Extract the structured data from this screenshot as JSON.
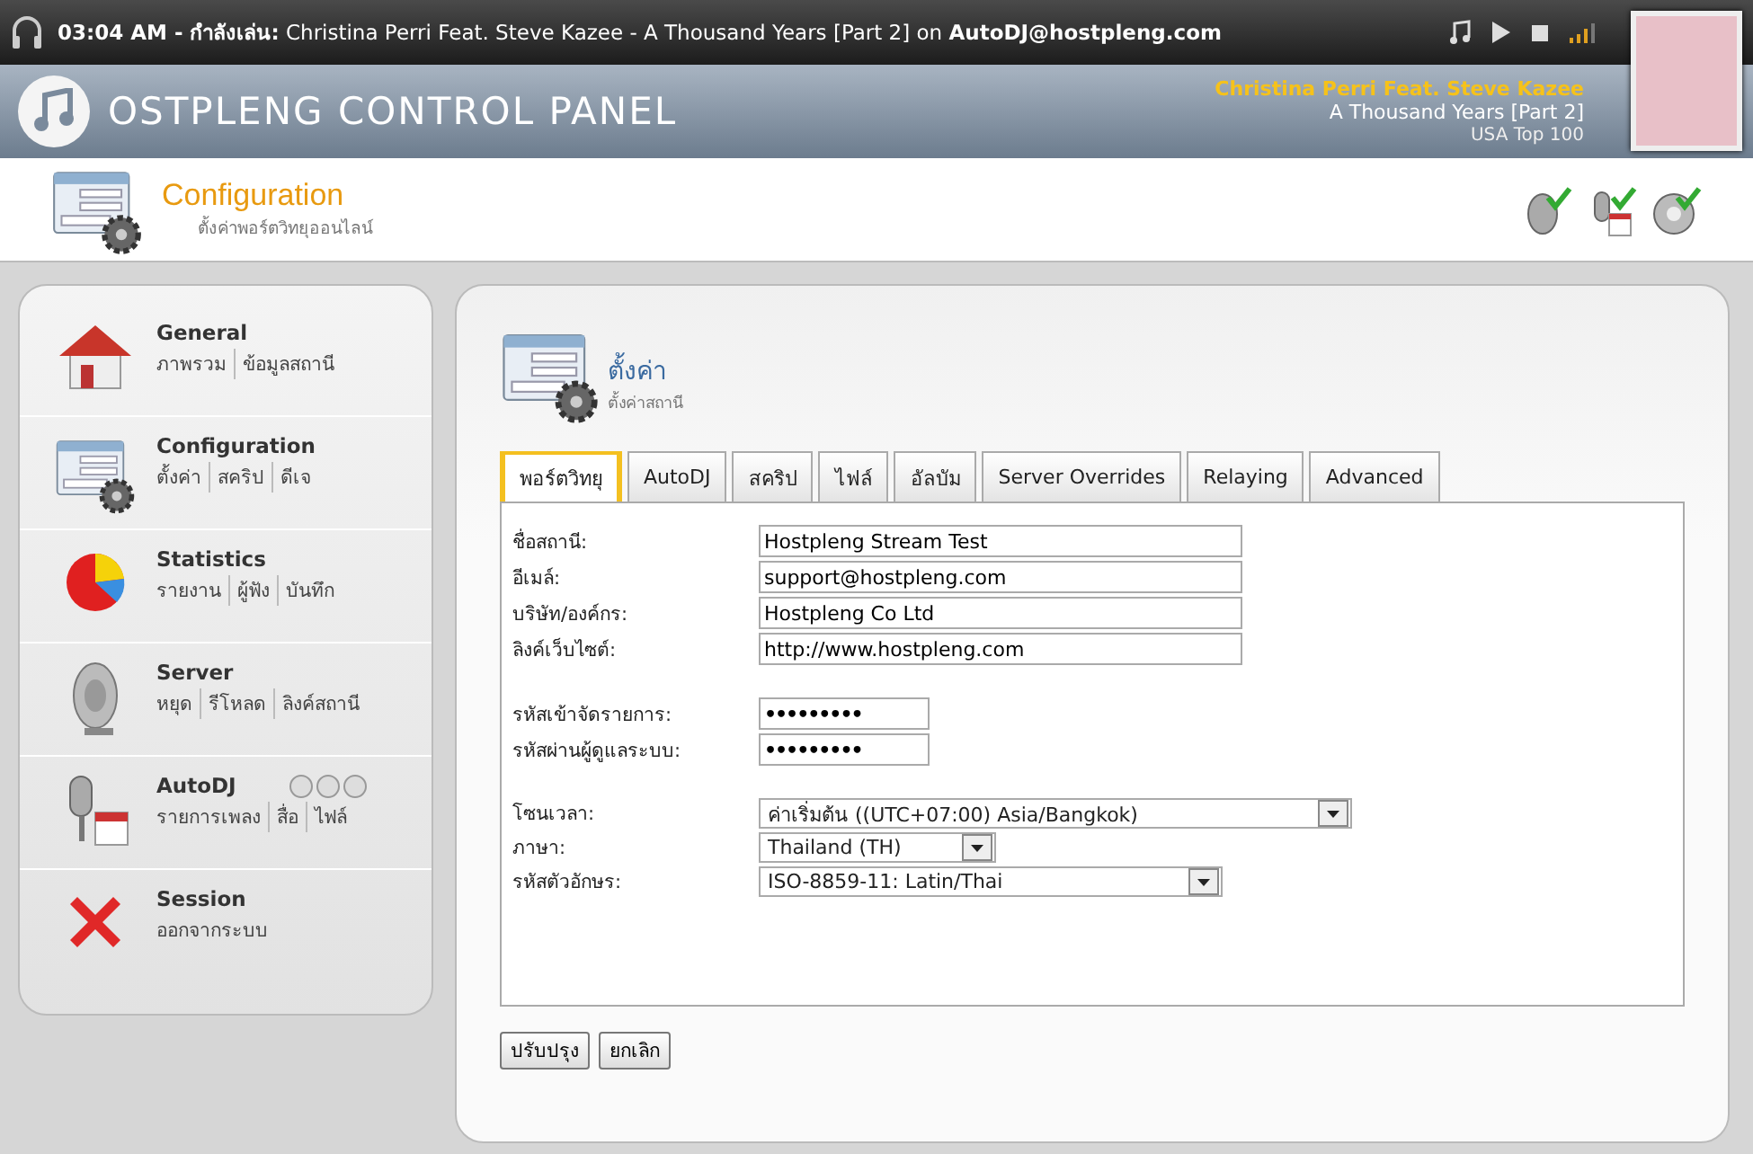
{
  "now_playing_bar": {
    "text": "**03:04 AM - กำลังเล่น:** Christina Perri Feat. Steve Kazee - A Thousand Years [Part 2] on **AutoDJ@hostpleng.com**"
  },
  "header": {
    "title": "OSTPLENG CONTROL PANEL",
    "track": {
      "artist": "Christina Perri Feat. Steve Kazee",
      "title": "A Thousand Years [Part 2]",
      "chart": "USA Top 100"
    }
  },
  "page_header": {
    "title": "Configuration",
    "subtitle": "ตั้งค่าพอร์ตวิทยุออนไลน์"
  },
  "sidebar": {
    "items": [
      {
        "title": "General",
        "links": [
          "ภาพรวม",
          "ข้อมูลสถานี"
        ],
        "controls": false
      },
      {
        "title": "Configuration",
        "links": [
          "ตั้งค่า",
          "สคริป",
          "ดีเจ"
        ],
        "controls": false
      },
      {
        "title": "Statistics",
        "links": [
          "รายงาน",
          "ผู้ฟัง",
          "บันทึก"
        ],
        "controls": false
      },
      {
        "title": "Server",
        "links": [
          "หยุด",
          "รีโหลด",
          "ลิงค์สถานี"
        ],
        "controls": false
      },
      {
        "title": "AutoDJ",
        "links": [
          "รายการเพลง",
          "สื่อ",
          "ไฟล์"
        ],
        "controls": true
      },
      {
        "title": "Session",
        "links": [
          "ออกจากระบบ"
        ],
        "controls": false
      }
    ]
  },
  "panel": {
    "title": "ตั้งค่า",
    "subtitle": "ตั้งค่าสถานี",
    "tabs": [
      {
        "label": "พอร์ตวิทยุ",
        "selected": true
      },
      {
        "label": "AutoDJ",
        "selected": false
      },
      {
        "label": "สคริป",
        "selected": false
      },
      {
        "label": "ไฟล์",
        "selected": false
      },
      {
        "label": "อัลบัม",
        "selected": false
      },
      {
        "label": "Server Overrides",
        "selected": false
      },
      {
        "label": "Relaying",
        "selected": false
      },
      {
        "label": "Advanced",
        "selected": false
      }
    ],
    "groups": [
      [
        {
          "kind": "text",
          "label": "ชื่อสถานี:",
          "value": "Hostpleng Stream Test"
        },
        {
          "kind": "text",
          "label": "อีเมล์:",
          "value": "support@hostpleng.com"
        },
        {
          "kind": "text",
          "label": "บริษัท/องค์กร:",
          "value": "Hostpleng Co Ltd"
        },
        {
          "kind": "text",
          "label": "ลิงค์เว็บไซต์:",
          "value": "http://www.hostpleng.com"
        }
      ],
      [
        {
          "kind": "password",
          "label": "รหัสเข้าจัดรายการ:",
          "value": "•••••••••"
        },
        {
          "kind": "password",
          "label": "รหัสผ่านผู้ดูแลระบบ:",
          "value": "•••••••••"
        }
      ],
      [
        {
          "kind": "select",
          "label": "โซนเวลา:",
          "value": "ค่าเริ่มต้น ((UTC+07:00) Asia/Bangkok)"
        },
        {
          "kind": "select",
          "label": "ภาษา:",
          "value": "Thailand (TH)"
        },
        {
          "kind": "select",
          "label": "รหัสตัวอักษร:",
          "value": "ISO-8859-11: Latin/Thai"
        }
      ]
    ],
    "buttons": [
      "ปรับปรุง",
      "ยกเลิก"
    ]
  }
}
